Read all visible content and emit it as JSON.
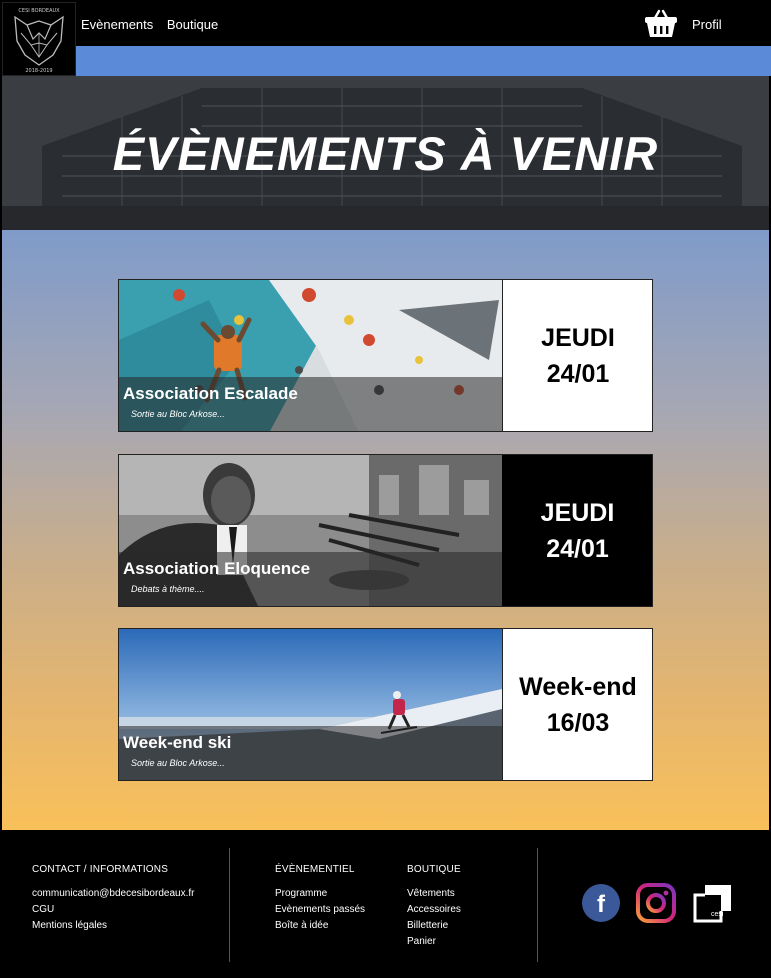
{
  "nav": {
    "events_label": "Evènements",
    "shop_label": "Boutique",
    "profile_label": "Profil",
    "cart_icon": "shopping-basket-icon",
    "logo_top_text": "CESI BORDEAUX",
    "logo_bottom_text": "2018-2019"
  },
  "hero": {
    "title": "ÉVÈNEMENTS À VENIR"
  },
  "events": [
    {
      "title": "Association Escalade",
      "subtitle": "Sortie au Bloc Arkose...",
      "date_line1": "JEUDI",
      "date_line2": "24/01",
      "theme": "light"
    },
    {
      "title": "Association Eloquence",
      "subtitle": "Debats à thème....",
      "date_line1": "JEUDI",
      "date_line2": "24/01",
      "theme": "dark"
    },
    {
      "title": "Week-end ski",
      "subtitle": "Sortie au Bloc Arkose...",
      "date_line1": "Week-end",
      "date_line2": "16/03",
      "theme": "light"
    }
  ],
  "footer": {
    "contact": {
      "heading": "CONTACT / INFORMATIONS",
      "links": [
        "communication@bdecesibordeaux.fr",
        "CGU",
        "Mentions légales"
      ]
    },
    "events": {
      "heading": "ÉVÈNEMENTIEL",
      "links": [
        "Programme",
        "Evènements passés",
        "Boîte à idée"
      ]
    },
    "shop": {
      "heading": "BOUTIQUE",
      "links": [
        "Vêtements",
        "Accessoires",
        "Billetterie",
        "Panier"
      ]
    },
    "social": {
      "facebook_letter": "f",
      "cesi_label": "cesi",
      "icons": [
        "facebook-icon",
        "instagram-icon",
        "cesi-icon"
      ]
    }
  },
  "colors": {
    "accent_blue": "#5b8ad8",
    "gradient_top": "#7f9bc9",
    "gradient_bottom": "#f9c05a",
    "facebook": "#3b5998"
  }
}
